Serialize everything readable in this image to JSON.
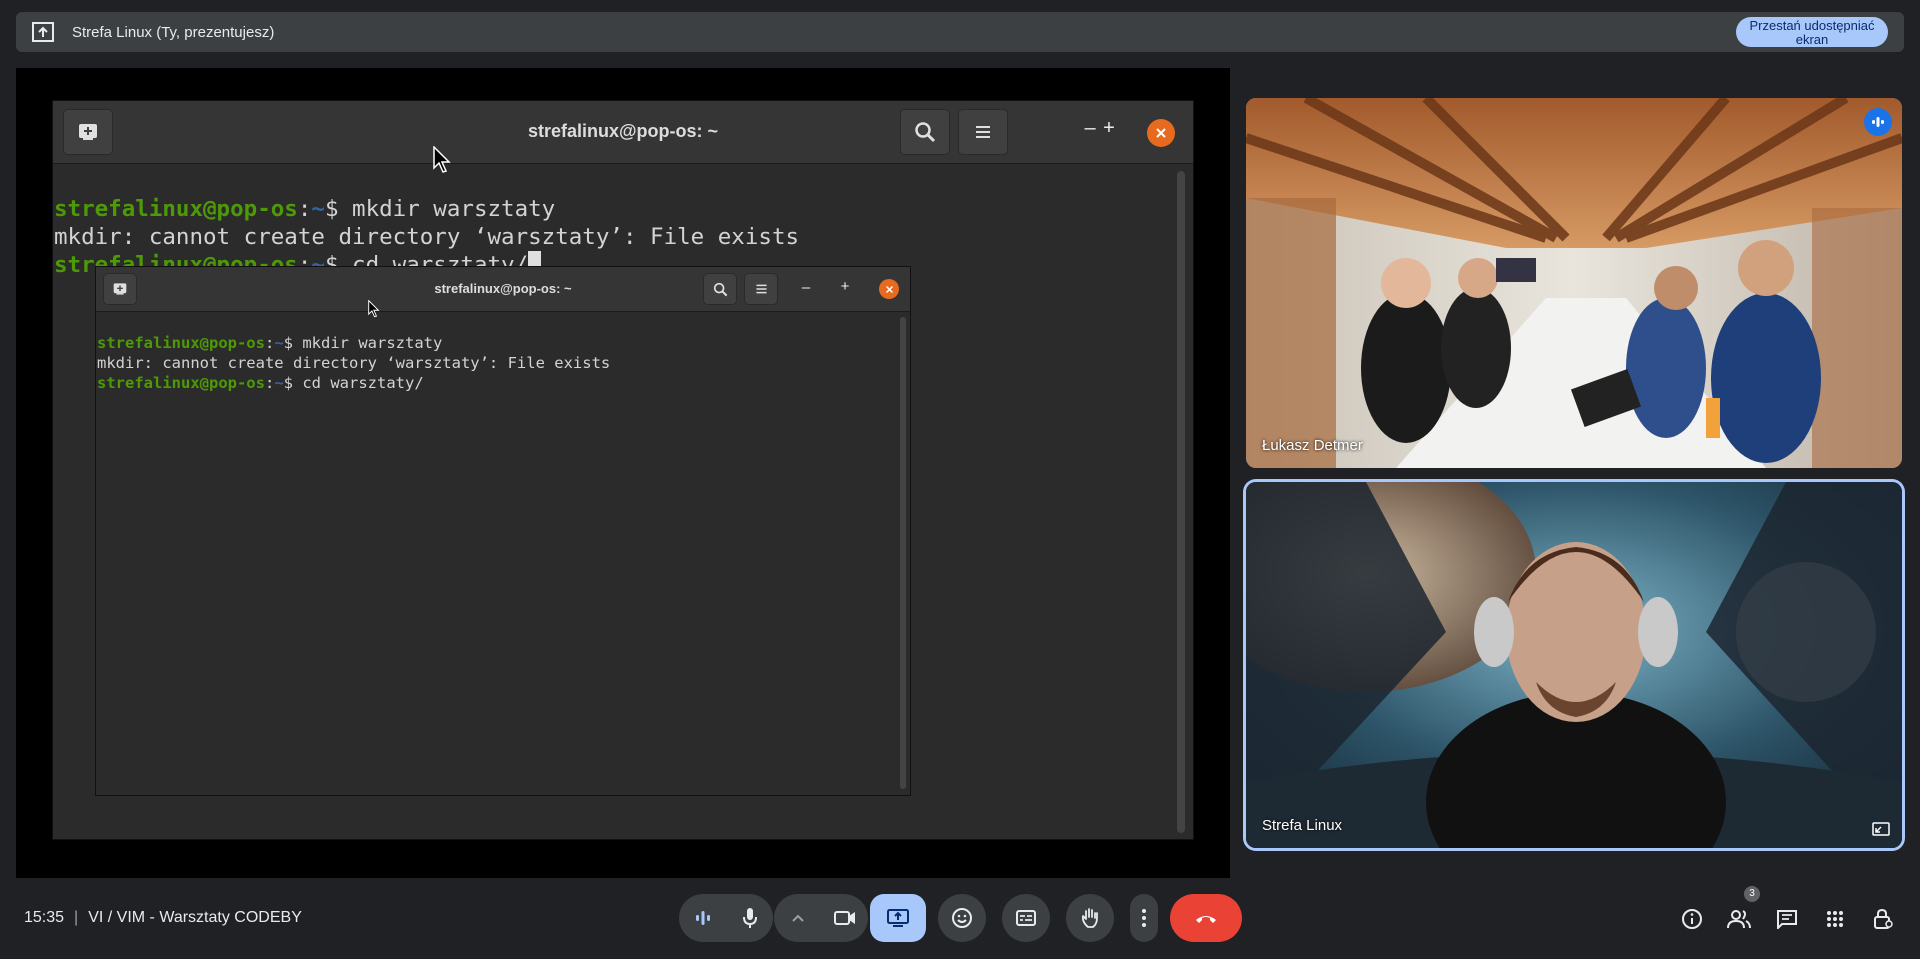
{
  "presentation_bar": {
    "title": "Strefa Linux (Ty, prezentujesz)",
    "stop_button": "Przestań udostępniać ekran"
  },
  "terminal_outer": {
    "title": "strefalinux@pop-os: ~",
    "line1_user": "strefalinux@pop-os",
    "line1_colon": ":",
    "line1_path": "~",
    "line1_cmd": "$ mkdir warsztaty",
    "line2": "mkdir: cannot create directory ‘warsztaty’: File exists",
    "line3_user": "strefalinux@pop-os",
    "line3_colon": ":",
    "line3_path": "~",
    "line3_cmd": "$ cd warsztaty/",
    "minimize": "–",
    "maximize": "+"
  },
  "terminal_inner": {
    "title": "strefalinux@pop-os: ~",
    "line1_user": "strefalinux@pop-os",
    "line1_colon": ":",
    "line1_path": "~",
    "line1_cmd": "$ mkdir warsztaty",
    "line2": "mkdir: cannot create directory ‘warsztaty’: File exists",
    "line3_user": "strefalinux@pop-os",
    "line3_colon": ":",
    "line3_path": "~",
    "line3_cmd": "$ cd warsztaty/",
    "minimize": "–",
    "maximize": "+"
  },
  "participants": [
    {
      "name": "Łukasz Detmer",
      "speaking": true
    },
    {
      "name": "Strefa Linux",
      "speaking": false
    }
  ],
  "bottom_bar": {
    "time": "15:35",
    "separator": "|",
    "meeting_title": "VI / VIM - Warsztaty CODEBY",
    "people_count": "3"
  },
  "icons": {
    "present": "present-to-all-icon",
    "audio_levels": "audio-levels-icon",
    "mic": "microphone-icon",
    "more_camera": "chevron-up-icon",
    "camera": "camera-icon",
    "present_now": "present-screen-icon",
    "emoji": "emoji-icon",
    "captions": "captions-icon",
    "raise_hand": "raise-hand-icon",
    "more": "more-vert-icon",
    "end_call": "end-call-icon",
    "info": "info-icon",
    "people": "people-icon",
    "chat": "chat-icon",
    "activities": "apps-icon",
    "host_controls": "lock-person-icon"
  },
  "colors": {
    "accent": "#a8c7fa",
    "end_call": "#ea4335",
    "prompt_green": "#4e9a06",
    "prompt_blue": "#3465a4",
    "close_orange": "#e66b1e"
  }
}
